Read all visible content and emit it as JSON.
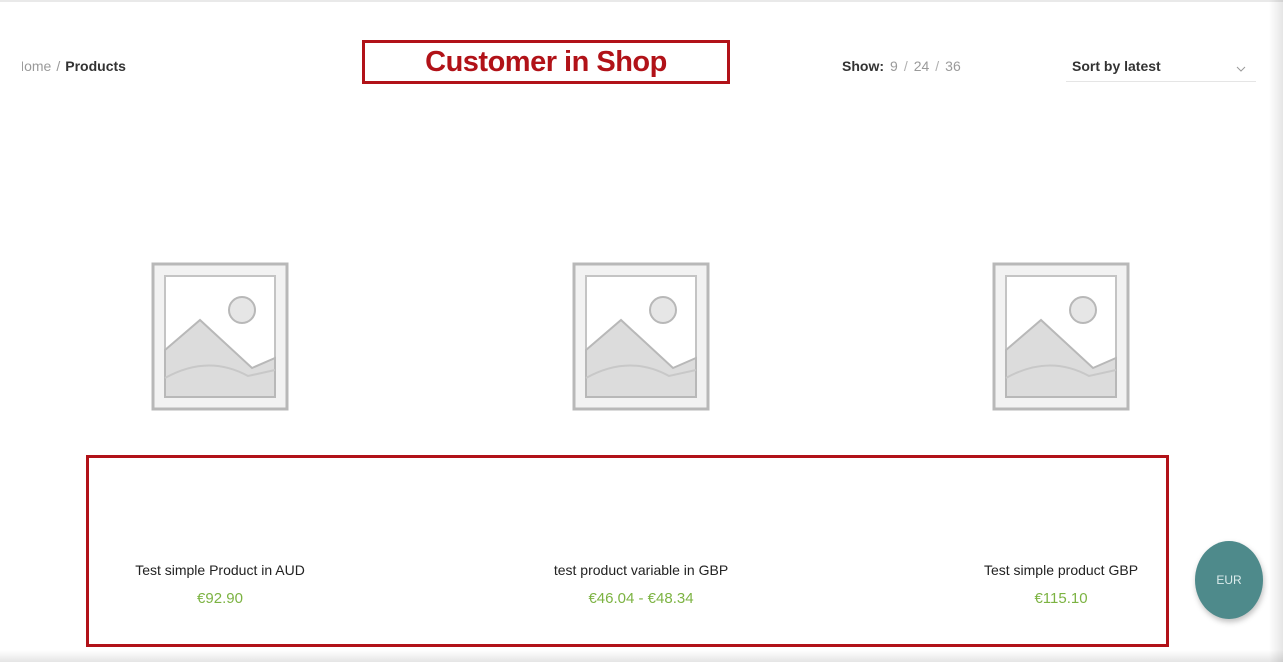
{
  "breadcrumb": {
    "home": "Home",
    "separator": "/",
    "current": "Products"
  },
  "annotations": {
    "title": "Customer in Shop",
    "color": "#b11218"
  },
  "toolbar": {
    "show_label": "Show",
    "show_colon": ":",
    "per_page_options": [
      "9",
      "24",
      "36"
    ],
    "sort_selected": "Sort by latest"
  },
  "products": [
    {
      "name": "Test simple Product in AUD",
      "price": "€92.90",
      "image": "placeholder-image-icon"
    },
    {
      "name": "test product variable in GBP",
      "price": "€46.04 - €48.34",
      "image": "placeholder-image-icon"
    },
    {
      "name": "Test simple product GBP",
      "price": "€115.10",
      "image": "placeholder-image-icon"
    }
  ],
  "currency_switcher": {
    "label": "EUR",
    "color": "#4e8a8b"
  },
  "colors": {
    "price": "#7cb342",
    "text": "#222222",
    "muted": "#9a9a9a"
  }
}
